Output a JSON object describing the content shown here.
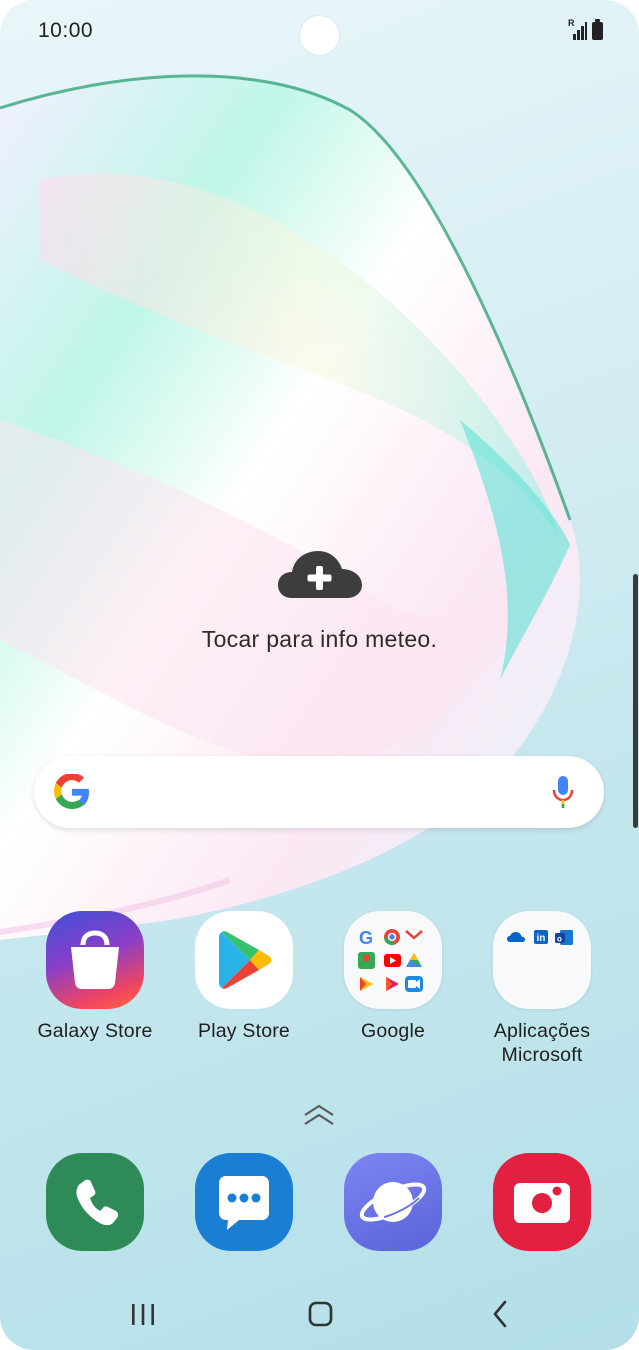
{
  "status_bar": {
    "time": "10:00",
    "signal_label": "R"
  },
  "weather": {
    "text": "Tocar para info meteo.",
    "icon": "cloud-plus-icon"
  },
  "search": {
    "logo": "google-g-icon",
    "mic": "mic-icon"
  },
  "apps": [
    {
      "label": "Galaxy Store",
      "icon": "galaxy-store-icon"
    },
    {
      "label": "Play Store",
      "icon": "play-store-icon"
    },
    {
      "label": "Google",
      "icon": "google-folder-icon"
    },
    {
      "label_line1": "Aplicações",
      "label_line2": "Microsoft",
      "icon": "microsoft-folder-icon"
    }
  ],
  "dock": [
    {
      "icon": "phone-icon"
    },
    {
      "icon": "messages-icon"
    },
    {
      "icon": "internet-icon"
    },
    {
      "icon": "camera-icon"
    }
  ],
  "nav": {
    "recents": "recents-icon",
    "home": "home-icon",
    "back": "back-icon"
  },
  "colors": {
    "phone": "#2e8b57",
    "messages": "#1a7fd4",
    "internet": "#6b74e8",
    "camera": "#e2203f",
    "google_blue": "#4285F4",
    "google_red": "#EA4335",
    "google_yellow": "#FBBC05",
    "google_green": "#34A853"
  }
}
